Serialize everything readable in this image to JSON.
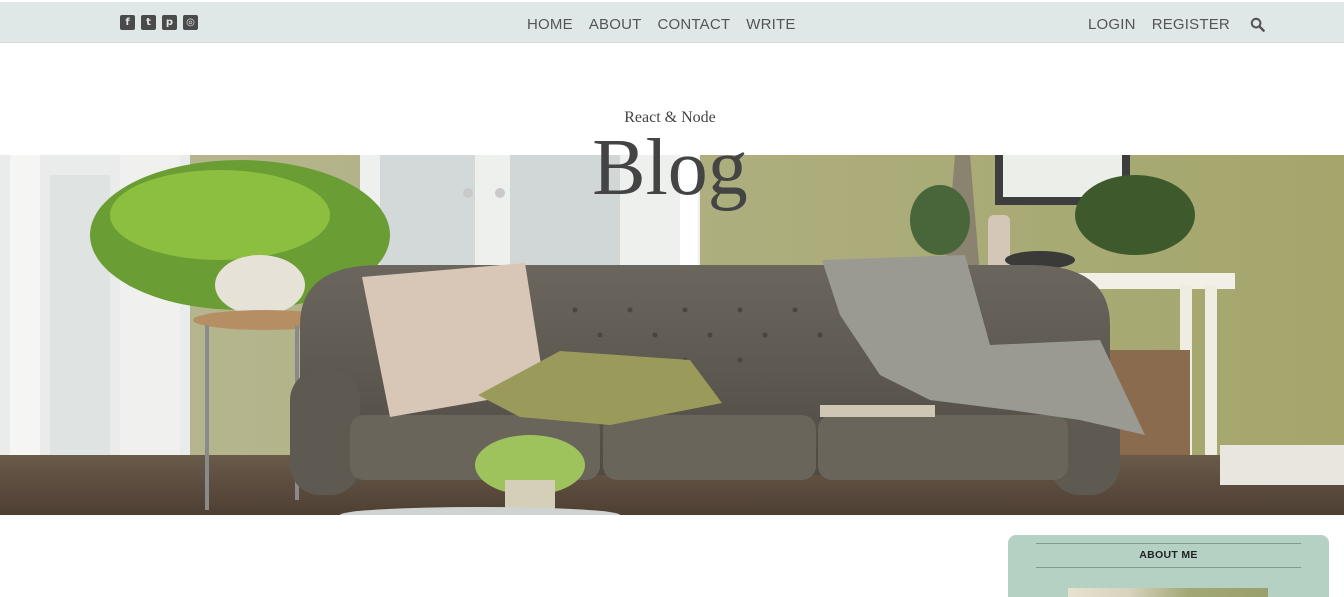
{
  "topbar": {
    "social_icons": [
      "facebook-icon",
      "twitter-icon",
      "pinterest-icon",
      "instagram-icon"
    ],
    "nav_center": [
      "HOME",
      "ABOUT",
      "CONTACT",
      "WRITE"
    ],
    "nav_right": [
      "LOGIN",
      "REGISTER"
    ],
    "search_icon": "search-icon",
    "bar_color": "#e0e7e7"
  },
  "header": {
    "subtitle": "React & Node",
    "title": "Blog"
  },
  "sidebar": {
    "heading": "ABOUT ME",
    "bg_color": "#b5d1c4"
  }
}
